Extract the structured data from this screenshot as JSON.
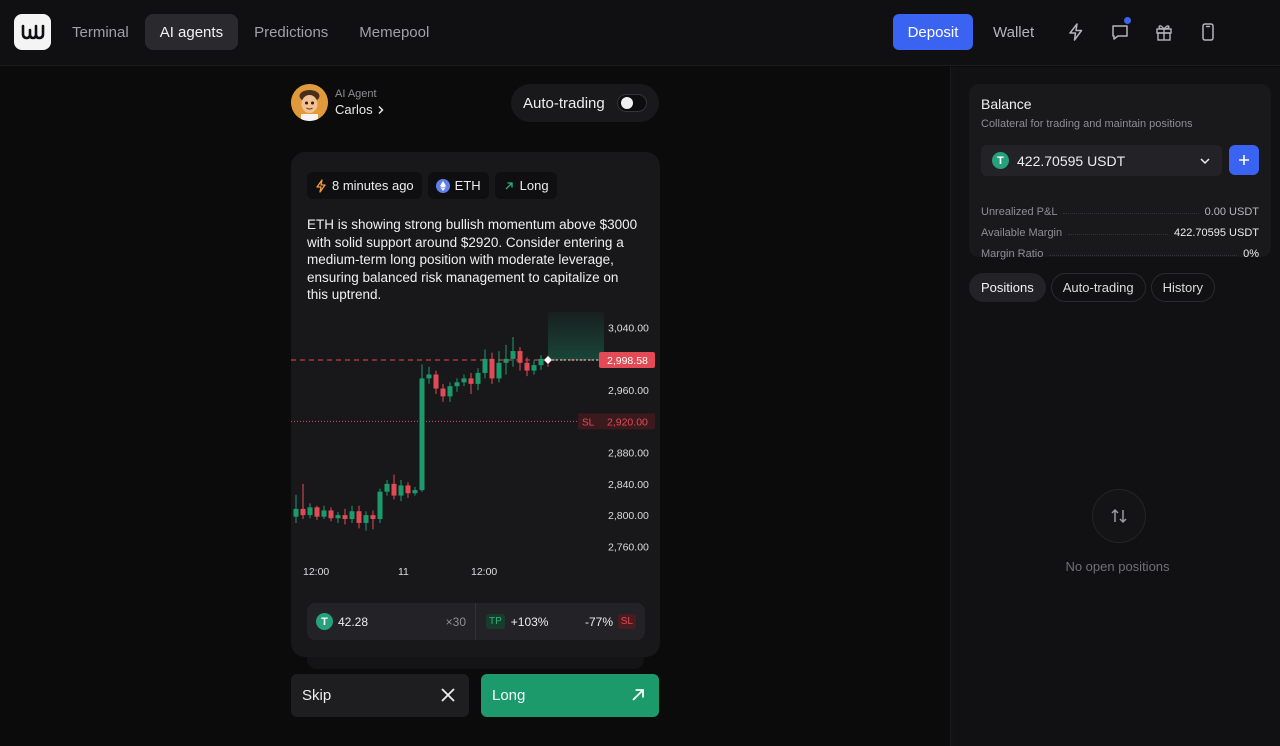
{
  "nav": {
    "items": [
      {
        "label": "Terminal",
        "active": false
      },
      {
        "label": "AI agents",
        "active": true
      },
      {
        "label": "Predictions",
        "active": false
      },
      {
        "label": "Memepool",
        "active": false
      }
    ],
    "deposit_label": "Deposit",
    "wallet_label": "Wallet",
    "icons": [
      "lightning-icon",
      "chat-icon",
      "gift-icon",
      "phone-icon"
    ]
  },
  "agent": {
    "sub_label": "AI Agent",
    "name": "Carlos",
    "auto_trading_label": "Auto-trading",
    "auto_trading_enabled": false
  },
  "signal": {
    "time": "8 minutes ago",
    "asset": "ETH",
    "direction": "Long",
    "description": "ETH is showing strong bullish momentum above $3000 with solid support around $2920. Consider entering a medium-term long position with moderate leverage, ensuring balanced risk management to capitalize on this uptrend.",
    "amount": "42.28",
    "leverage": "×30",
    "tp_label": "TP",
    "tp_value": "+103%",
    "sl_value": "-77%",
    "sl_label": "SL"
  },
  "chart_data": {
    "type": "candlestick",
    "y_ticks": [
      "3,040.00",
      "2,960.00",
      "2,880.00",
      "2,840.00",
      "2,800.00",
      "2,760.00"
    ],
    "x_ticks": [
      "12:00",
      "11",
      "12:00"
    ],
    "current_price": "2,998.58",
    "sl_price": "2,920.00",
    "sl_label": "SL",
    "ylim": [
      2740,
      3060
    ],
    "candles": [
      [
        2798,
        2808,
        2790,
        2826
      ],
      [
        2808,
        2800,
        2795,
        2840
      ],
      [
        2800,
        2810,
        2796,
        2815
      ],
      [
        2810,
        2798,
        2794,
        2812
      ],
      [
        2798,
        2806,
        2795,
        2812
      ],
      [
        2806,
        2796,
        2792,
        2810
      ],
      [
        2796,
        2800,
        2790,
        2804
      ],
      [
        2800,
        2795,
        2788,
        2808
      ],
      [
        2795,
        2805,
        2790,
        2812
      ],
      [
        2805,
        2790,
        2783,
        2812
      ],
      [
        2790,
        2800,
        2780,
        2805
      ],
      [
        2800,
        2795,
        2782,
        2806
      ],
      [
        2795,
        2830,
        2790,
        2834
      ],
      [
        2830,
        2840,
        2825,
        2845
      ],
      [
        2840,
        2825,
        2820,
        2852
      ],
      [
        2825,
        2838,
        2818,
        2845
      ],
      [
        2838,
        2828,
        2822,
        2842
      ],
      [
        2828,
        2832,
        2825,
        2836
      ],
      [
        2832,
        2975,
        2830,
        2993
      ],
      [
        2975,
        2980,
        2968,
        2990
      ],
      [
        2980,
        2962,
        2955,
        2985
      ],
      [
        2962,
        2952,
        2945,
        2968
      ],
      [
        2952,
        2965,
        2945,
        2970
      ],
      [
        2965,
        2970,
        2958,
        2975
      ],
      [
        2970,
        2975,
        2965,
        2980
      ],
      [
        2975,
        2968,
        2955,
        2982
      ],
      [
        2968,
        2982,
        2960,
        2988
      ],
      [
        2982,
        3000,
        2975,
        3012
      ],
      [
        3000,
        2975,
        2968,
        3008
      ],
      [
        2975,
        2995,
        2970,
        3010
      ],
      [
        2995,
        3000,
        2980,
        3018
      ],
      [
        3000,
        3010,
        2990,
        3028
      ],
      [
        3010,
        2995,
        2985,
        3015
      ],
      [
        2995,
        2985,
        2978,
        3002
      ],
      [
        2985,
        2992,
        2980,
        2998
      ],
      [
        2992,
        3000,
        2986,
        3005
      ],
      [
        3000,
        2998,
        2990,
        3004
      ]
    ],
    "tp_zone": {
      "y_from": 2998.58,
      "y_to": 3065
    }
  },
  "actions": {
    "skip_label": "Skip",
    "long_label": "Long"
  },
  "balance": {
    "title": "Balance",
    "subtitle": "Collateral for trading and maintain positions",
    "amount": "422.70595 USDT",
    "rows": [
      {
        "label": "Unrealized P&L",
        "value": "0.00 USDT"
      },
      {
        "label": "Available Margin",
        "value": "422.70595 USDT"
      },
      {
        "label": "Margin Ratio",
        "value": "0%"
      }
    ]
  },
  "positions": {
    "tabs": [
      "Positions",
      "Auto-trading",
      "History"
    ],
    "active_tab": "Positions",
    "empty_text": "No open positions"
  },
  "colors": {
    "accent": "#3a63f2",
    "up": "#1c9a6c",
    "down": "#e24a55"
  }
}
